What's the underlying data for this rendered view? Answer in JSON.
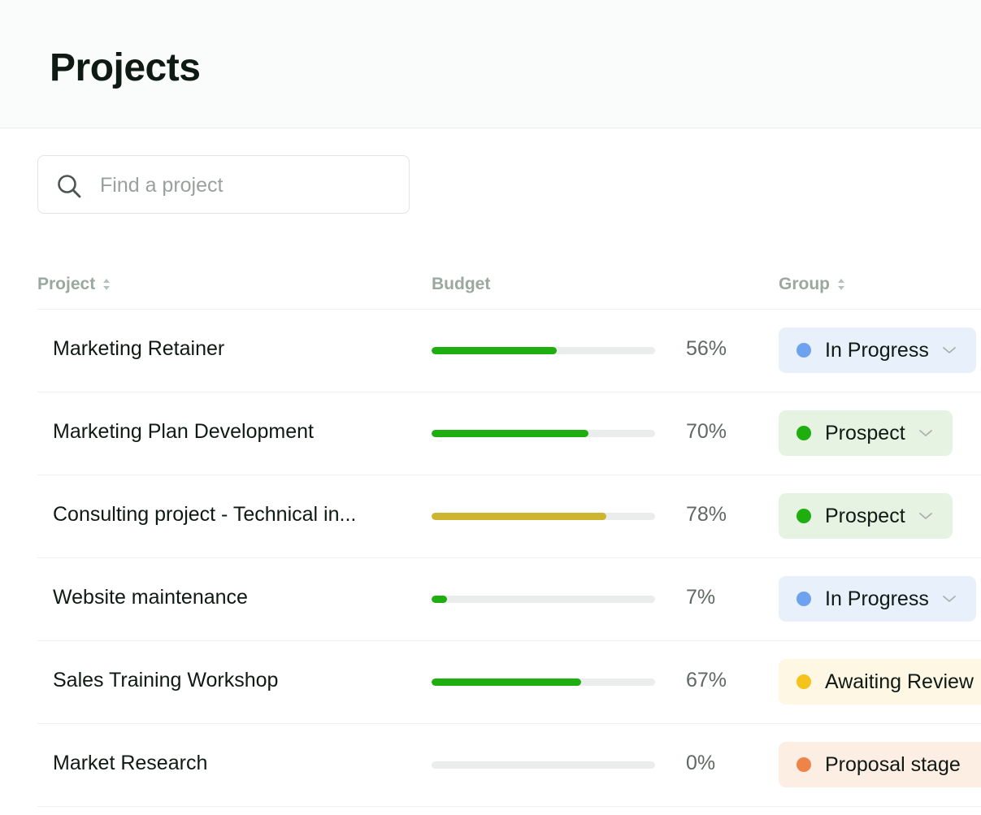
{
  "header": {
    "title": "Projects"
  },
  "search": {
    "placeholder": "Find a project",
    "value": ""
  },
  "table": {
    "columns": {
      "project": "Project",
      "budget": "Budget",
      "group": "Group"
    },
    "rows": [
      {
        "name": "Marketing Retainer",
        "budget_fraction": 0.56,
        "budget_label": "56%",
        "bar_color": "#1fae0f",
        "group": "In Progress",
        "group_bg": "#e8f0fc",
        "group_dot": "#6fa2ee",
        "chevron": true
      },
      {
        "name": "Marketing Plan Development",
        "budget_fraction": 0.7,
        "budget_label": "70%",
        "bar_color": "#1fae0f",
        "group": "Prospect",
        "group_bg": "#e6f3e3",
        "group_dot": "#1fae0f",
        "chevron": true
      },
      {
        "name": "Consulting project - Technical in...",
        "budget_fraction": 0.78,
        "budget_label": "78%",
        "bar_color": "#cdb530",
        "group": "Prospect",
        "group_bg": "#e6f3e3",
        "group_dot": "#1fae0f",
        "chevron": true
      },
      {
        "name": "Website maintenance",
        "budget_fraction": 0.07,
        "budget_label": "7%",
        "bar_color": "#1fae0f",
        "group": "In Progress",
        "group_bg": "#e8f0fc",
        "group_dot": "#6fa2ee",
        "chevron": true
      },
      {
        "name": "Sales Training Workshop",
        "budget_fraction": 0.67,
        "budget_label": "67%",
        "bar_color": "#1fae0f",
        "group": "Awaiting Review",
        "group_bg": "#fdf7e4",
        "group_dot": "#f6c21c",
        "chevron": false
      },
      {
        "name": "Market Research",
        "budget_fraction": 0.0,
        "budget_label": "0%",
        "bar_color": "#1fae0f",
        "group": "Proposal stage",
        "group_bg": "#fdeee4",
        "group_dot": "#ee8447",
        "chevron": false
      }
    ]
  },
  "icons": {
    "search": "search-icon",
    "sort": "sort-icon",
    "chevron": "chevron-down-icon"
  }
}
